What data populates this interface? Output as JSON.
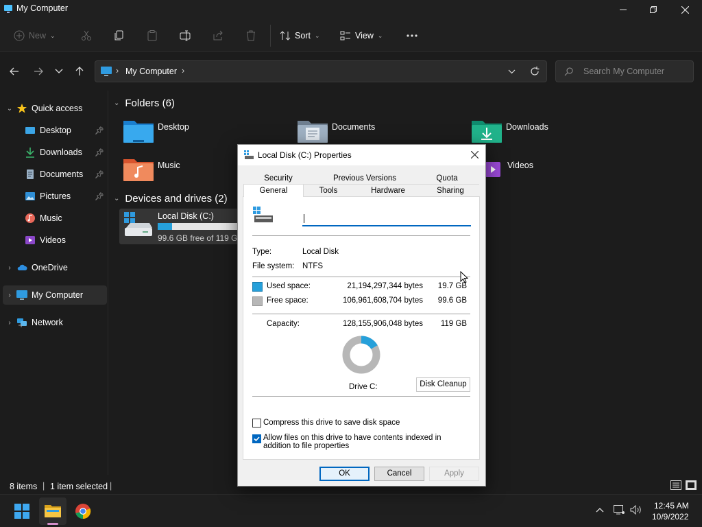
{
  "window": {
    "title": "My Computer"
  },
  "toolbar": {
    "new": "New",
    "sort": "Sort",
    "view": "View"
  },
  "address": {
    "location": "My Computer",
    "search_placeholder": "Search My Computer"
  },
  "sidebar": {
    "quick_access": "Quick access",
    "items": [
      "Desktop",
      "Downloads",
      "Documents",
      "Pictures",
      "Music",
      "Videos"
    ],
    "onedrive": "OneDrive",
    "my_computer": "My Computer",
    "network": "Network"
  },
  "main": {
    "folders_header": "Folders (6)",
    "folders": [
      "Desktop",
      "Documents",
      "Downloads",
      "Music",
      "Videos"
    ],
    "devices_header": "Devices and drives (2)",
    "drive": {
      "name": "Local Disk (C:)",
      "free_text": "99.6 GB free of 119 GB",
      "used_fraction": 0.165
    }
  },
  "status": {
    "items": "8 items",
    "selected": "1 item selected"
  },
  "taskbar": {
    "time": "12:45 AM",
    "date": "10/9/2022"
  },
  "dialog": {
    "title": "Local Disk (C:) Properties",
    "tabs_row1": [
      "Security",
      "Previous Versions",
      "Quota"
    ],
    "tabs_row2": [
      "General",
      "Tools",
      "Hardware",
      "Sharing"
    ],
    "name_value": "",
    "type_label": "Type:",
    "type_value": "Local Disk",
    "fs_label": "File system:",
    "fs_value": "NTFS",
    "used_label": "Used space:",
    "used_bytes": "21,194,297,344 bytes",
    "used_gb": "19.7 GB",
    "free_label": "Free space:",
    "free_bytes": "106,961,608,704 bytes",
    "free_gb": "99.6 GB",
    "capacity_label": "Capacity:",
    "capacity_bytes": "128,155,906,048 bytes",
    "capacity_gb": "119 GB",
    "drive_label": "Drive C:",
    "disk_cleanup": "Disk Cleanup",
    "compress_label": "Compress this drive to save disk space",
    "compress_checked": false,
    "index_label": "Allow files on this drive to have contents indexed in addition to file properties",
    "index_checked": true,
    "ok": "OK",
    "cancel": "Cancel",
    "apply": "Apply",
    "colors": {
      "used": "#26a0da",
      "free": "#b7b7b7"
    }
  }
}
